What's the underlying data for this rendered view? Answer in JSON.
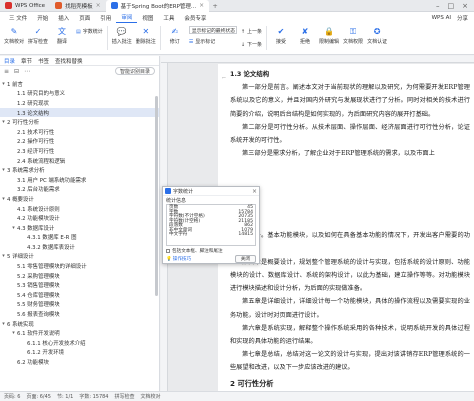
{
  "tabs": [
    {
      "label": "WPS Office",
      "color": "#d9302c"
    },
    {
      "label": "找稻壳模板",
      "color": "#e05b2b"
    },
    {
      "label": "基于Spring Boot的ERP管理...",
      "color": "#2b6fe8"
    }
  ],
  "menu": {
    "items": [
      "三 文件",
      "开始",
      "插入",
      "页面",
      "引用",
      "审阅",
      "视图",
      "工具",
      "会员专享"
    ],
    "active_index": 5,
    "right": [
      "WPS AI",
      "分享"
    ]
  },
  "ribbon": {
    "big": [
      "文档校对",
      "拼写检查",
      "翻译",
      "字数统计",
      "插入批注",
      "删除批注",
      "修订",
      "显示标记"
    ],
    "select_value": "显示标记的最终状态",
    "small": [
      "上一条",
      "下一条",
      "接受",
      "拒绝",
      "限制编辑",
      "文档权限",
      "文档认证"
    ],
    "accent": "#2b6fe8"
  },
  "nav": {
    "tabs": [
      "目录",
      "章节",
      "书签",
      "查找和替换"
    ],
    "smart_button": "智能识别目录",
    "items": [
      {
        "label": "1 前言",
        "level": 1,
        "arrow": "▾"
      },
      {
        "label": "1.1 研究目的与意义",
        "level": 2,
        "arrow": ""
      },
      {
        "label": "1.2 研究现状",
        "level": 2,
        "arrow": ""
      },
      {
        "label": "1.3 论文结构",
        "level": 2,
        "arrow": "",
        "selected": true
      },
      {
        "label": "2 可行性分析",
        "level": 1,
        "arrow": "▾"
      },
      {
        "label": "2.1 技术可行性",
        "level": 2,
        "arrow": ""
      },
      {
        "label": "2.2 操作可行性",
        "level": 2,
        "arrow": ""
      },
      {
        "label": "2.3 经济可行性",
        "level": 2,
        "arrow": ""
      },
      {
        "label": "2.4 系统流程和逻辑",
        "level": 2,
        "arrow": ""
      },
      {
        "label": "3 系统需求分析",
        "level": 1,
        "arrow": "▾"
      },
      {
        "label": "3.1 用户 PC 端系统功能需求",
        "level": 2,
        "arrow": ""
      },
      {
        "label": "3.2 后台功能需求",
        "level": 2,
        "arrow": ""
      },
      {
        "label": "4 概要设计",
        "level": 1,
        "arrow": "▾"
      },
      {
        "label": "4.1 系统设计原则",
        "level": 2,
        "arrow": ""
      },
      {
        "label": "4.2 功能模块设计",
        "level": 2,
        "arrow": ""
      },
      {
        "label": "4.3 数据库设计",
        "level": 2,
        "arrow": "▾"
      },
      {
        "label": "4.3.1 数据库 E-R 图",
        "level": 3,
        "arrow": ""
      },
      {
        "label": "4.3.2 数据库表设计",
        "level": 3,
        "arrow": ""
      },
      {
        "label": "5 详细设计",
        "level": 1,
        "arrow": "▾"
      },
      {
        "label": "5.1 零售管理模块的详细设计",
        "level": 2,
        "arrow": ""
      },
      {
        "label": "5.2 采购管理模块",
        "level": 2,
        "arrow": ""
      },
      {
        "label": "5.3 销售管理模块",
        "level": 2,
        "arrow": ""
      },
      {
        "label": "5.4 仓库管理模块",
        "level": 2,
        "arrow": ""
      },
      {
        "label": "5.5 财务管理模块",
        "level": 2,
        "arrow": ""
      },
      {
        "label": "5.6 报表查询模块",
        "level": 2,
        "arrow": ""
      },
      {
        "label": "6 系统实现",
        "level": 1,
        "arrow": "▾"
      },
      {
        "label": "6.1 软件开发说明",
        "level": 2,
        "arrow": "▾"
      },
      {
        "label": "6.1.1 核心开发技术介绍",
        "level": 3,
        "arrow": ""
      },
      {
        "label": "6.1.2 开发环境",
        "level": 3,
        "arrow": ""
      },
      {
        "label": "6.2 功能模块",
        "level": 2,
        "arrow": ""
      }
    ]
  },
  "document": {
    "heading_13": "1.3  论文结构",
    "para1": "第一部分是前言。阐述本文对于当前现状的理解以及研究，为何需要开发ERP管理系统以及它的意义，并且对国内外研究与发展现状进行了分析。同时对相关的技术进行简要的介绍，说明后台结构是如何实现的，为后面研究内容的展开打基础。",
    "para2": "第二部分是可行性分析。从技术层面、操作层面、经济层面进行可行性分析，论证系统开发的可行性。",
    "para3": "第三部分是需求分析，了解企业对于ERP管理系统的需求，以及市面上",
    "para4": "的分析。基本功能模块，以及如何在具备基本功能的情况下，开发出客户需要的功能。",
    "para5": "第四章是概要设计，规划整个管理系统的设计与实现，包括系统的设计原则、功能模块的设计、数据库设计、系统的架构设计，以此为基础，建立操作等等。对功能模块进行模块描述和设计分析，为后面的实现做准备。",
    "para6": "第五章是详细设计，详细设计每一个功能模块，具体的操作流程以及需要实现的业务功能，设计时对页面进行设计。",
    "para7": "第六章是系统实现，解释整个操作系统采用的各种技术，说明系统开发的具体过程和实现的具体功能的运行结果。",
    "para8": "第七章是总结，总结对这一论文的设计与实现，提出对该讲销存ERP管理系统的一些展望和改进，以及下一步应该改进的建议。",
    "heading_2": "2  可行性分析"
  },
  "dialog": {
    "title": "字数统计",
    "section": "统计信息",
    "rows": [
      {
        "label": "页数",
        "value": "45"
      },
      {
        "label": "字数",
        "value": "15784"
      },
      {
        "label": "字符数(不计空格)",
        "value": "20735"
      },
      {
        "label": "字符数(计空格)",
        "value": "21185"
      },
      {
        "label": "段落数",
        "value": "862"
      },
      {
        "label": "非中文单词",
        "value": "1079"
      },
      {
        "label": "中文字符",
        "value": "14815"
      }
    ],
    "checkbox": "包括文本框、脚注和尾注",
    "tip": "操作技巧",
    "close": "关闭"
  },
  "status": {
    "items": [
      "页码: 6",
      "页面: 6/45",
      "节: 1/1",
      "字数: 15784",
      "拼写检查",
      "文档校对"
    ]
  }
}
